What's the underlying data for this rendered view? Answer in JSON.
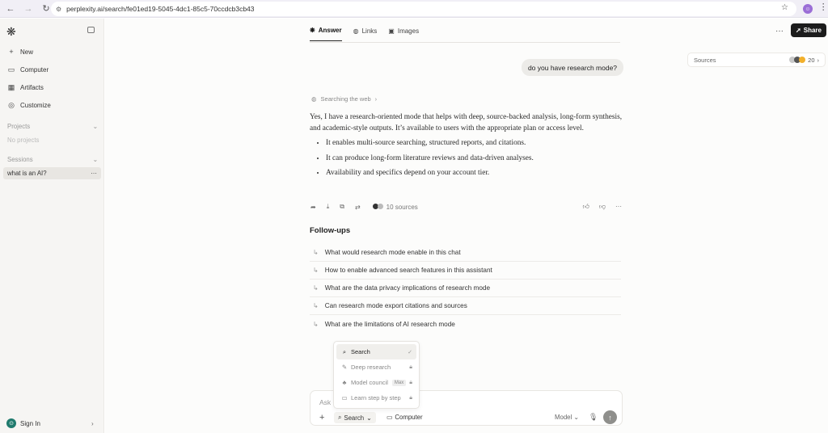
{
  "browser": {
    "url": "perplexity.ai/search/fe01ed19-5045-4dc1-85c5-70ccdcb3cb43",
    "profile_initial": "☺"
  },
  "sidebar": {
    "nav": [
      {
        "label": "New",
        "icon": "plus-icon"
      },
      {
        "label": "Computer",
        "icon": "monitor-icon"
      },
      {
        "label": "Artifacts",
        "icon": "artifacts-icon"
      },
      {
        "label": "Customize",
        "icon": "gear-icon"
      }
    ],
    "projects_label": "Projects",
    "no_projects": "No projects",
    "sessions_label": "Sessions",
    "session_item": "what is an AI?",
    "sign_in": "Sign In"
  },
  "header": {
    "tabs": [
      "Answer",
      "Links",
      "Images"
    ],
    "share": "Share"
  },
  "sources": {
    "label": "Sources",
    "count": "20"
  },
  "query": "do you have research mode?",
  "searching": "Searching the web",
  "answer": {
    "paragraph": "Yes, I have a research-oriented mode that helps with deep, source-backed analysis, long-form synthesis, and academic-style outputs. It’s available to users with the appropriate plan or access level.",
    "bullets": [
      "It enables multi-source searching, structured reports, and citations.",
      "It can produce long-form literature reviews and data-driven analyses.",
      "Availability and specifics depend on your account tier."
    ]
  },
  "answer_sources": "10 sources",
  "followups": {
    "title": "Follow-ups",
    "items": [
      "What would research mode enable in this chat",
      "How to enable advanced search features in this assistant",
      "What are the data privacy implications of research mode",
      "Can research mode export citations and sources",
      "What are the limitations of AI research mode"
    ]
  },
  "mode_menu": {
    "items": [
      "Search",
      "Deep research",
      "Model council",
      "Learn step by step"
    ],
    "max_badge": "Max"
  },
  "composer": {
    "placeholder": "Ask",
    "search": "Search",
    "computer": "Computer",
    "model": "Model"
  },
  "colors": {
    "sidebar_bg": "#f6f5f3",
    "share_bg": "#1c1c1c",
    "avatar": "#1f7a6d",
    "profile": "#9b6ed6"
  }
}
